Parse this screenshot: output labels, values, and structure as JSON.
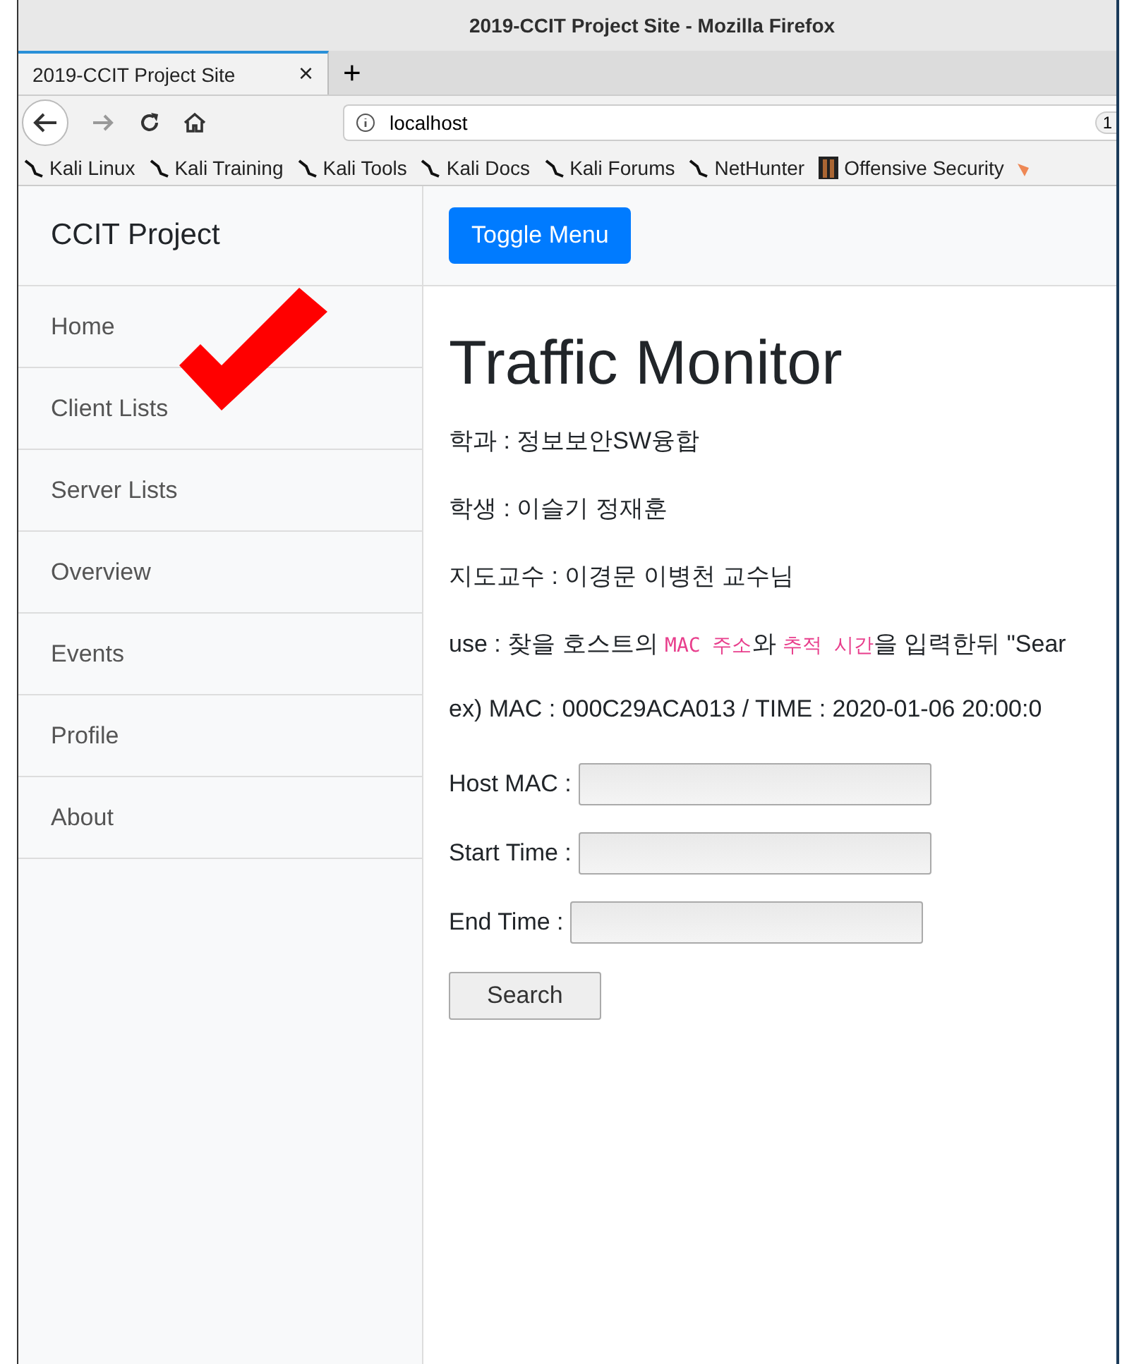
{
  "window": {
    "title": "2019-CCIT Project Site - Mozilla Firefox"
  },
  "tabs": [
    {
      "label": "2019-CCIT Project Site",
      "selected": true,
      "close": "×"
    }
  ],
  "new_tab": "+",
  "address_bar": {
    "url": "localhost",
    "zoom": "1"
  },
  "bookmarks": [
    {
      "label": "Kali Linux",
      "kind": "kali"
    },
    {
      "label": "Kali Training",
      "kind": "kali"
    },
    {
      "label": "Kali Tools",
      "kind": "kali"
    },
    {
      "label": "Kali Docs",
      "kind": "kali"
    },
    {
      "label": "Kali Forums",
      "kind": "kali"
    },
    {
      "label": "NetHunter",
      "kind": "kali"
    },
    {
      "label": "Offensive Security",
      "kind": "offsec"
    }
  ],
  "sidebar": {
    "brand": "CCIT Project",
    "items": [
      {
        "label": "Home"
      },
      {
        "label": "Client Lists"
      },
      {
        "label": "Server Lists"
      },
      {
        "label": "Overview"
      },
      {
        "label": "Events"
      },
      {
        "label": "Profile"
      },
      {
        "label": "About"
      }
    ]
  },
  "toggle_button": "Toggle Menu",
  "heading": "Traffic Monitor",
  "info_lines": [
    {
      "parts": [
        {
          "kind": "text",
          "text": "학과 : 정보보안SW융합"
        }
      ]
    },
    {
      "parts": [
        {
          "kind": "text",
          "text": "학생 : 이슬기 정재훈"
        }
      ]
    },
    {
      "parts": [
        {
          "kind": "text",
          "text": "지도교수 : 이경문 이병천 교수님"
        }
      ]
    },
    {
      "parts": [
        {
          "kind": "text",
          "text": "use : 찾을 호스트의 "
        },
        {
          "kind": "code",
          "text": "MAC 주소"
        },
        {
          "kind": "text",
          "text": "와 "
        },
        {
          "kind": "code",
          "text": "추적 시간"
        },
        {
          "kind": "text",
          "text": "을 입력한뒤 \"Sear"
        }
      ]
    },
    {
      "parts": [
        {
          "kind": "text",
          "text": "ex) MAC : 000C29ACA013 / TIME : 2020-01-06 20:00:0"
        }
      ]
    }
  ],
  "form": {
    "fields": [
      {
        "label": "Host MAC :"
      },
      {
        "label": "Start Time :"
      },
      {
        "label": "End Time :"
      }
    ],
    "submit": "Search"
  }
}
